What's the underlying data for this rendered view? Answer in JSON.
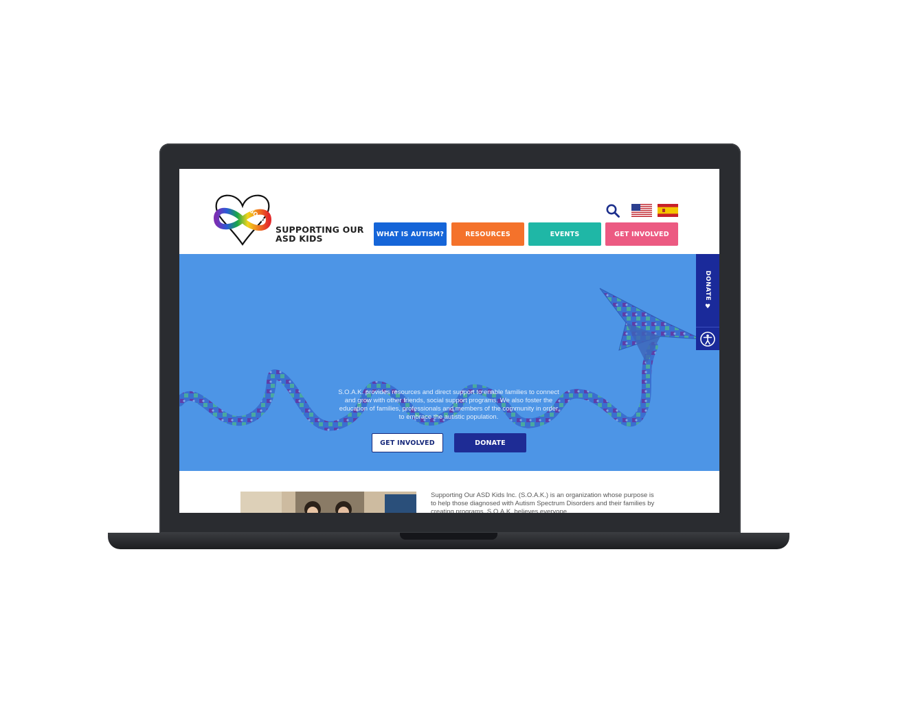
{
  "site": {
    "logo_badge": "SOAK",
    "logo_text": "SUPPORTING OUR\nASD KIDS"
  },
  "nav": {
    "items": [
      {
        "label": "WHAT IS AUTISM?",
        "color": "#1565d8"
      },
      {
        "label": "RESOURCES",
        "color": "#f4722b"
      },
      {
        "label": "EVENTS",
        "color": "#1fb7a6"
      },
      {
        "label": "GET INVOLVED",
        "color": "#ec5a82"
      }
    ]
  },
  "hero": {
    "text": "S.O.A.K. provides resources and direct support to enable families to connect and grow with other friends, social support programs. We also foster the education of families, professionals and members of the community in order to embrace the autistic population.",
    "get_involved_label": "GET INVOLVED",
    "donate_label": "DONATE",
    "background": "#4d95e6"
  },
  "side": {
    "donate_label": "DONATE ♥"
  },
  "about": {
    "text": "Supporting Our ASD Kids Inc. (S.O.A.K.) is an organization whose purpose is to help those diagnosed with Autism Spectrum Disorders and their families by creating programs. S.O.A.K. believes everyone..."
  },
  "icons": [
    "heart-infinity-logo",
    "search-icon",
    "us-flag-icon",
    "spain-flag-icon",
    "accessibility-icon"
  ]
}
